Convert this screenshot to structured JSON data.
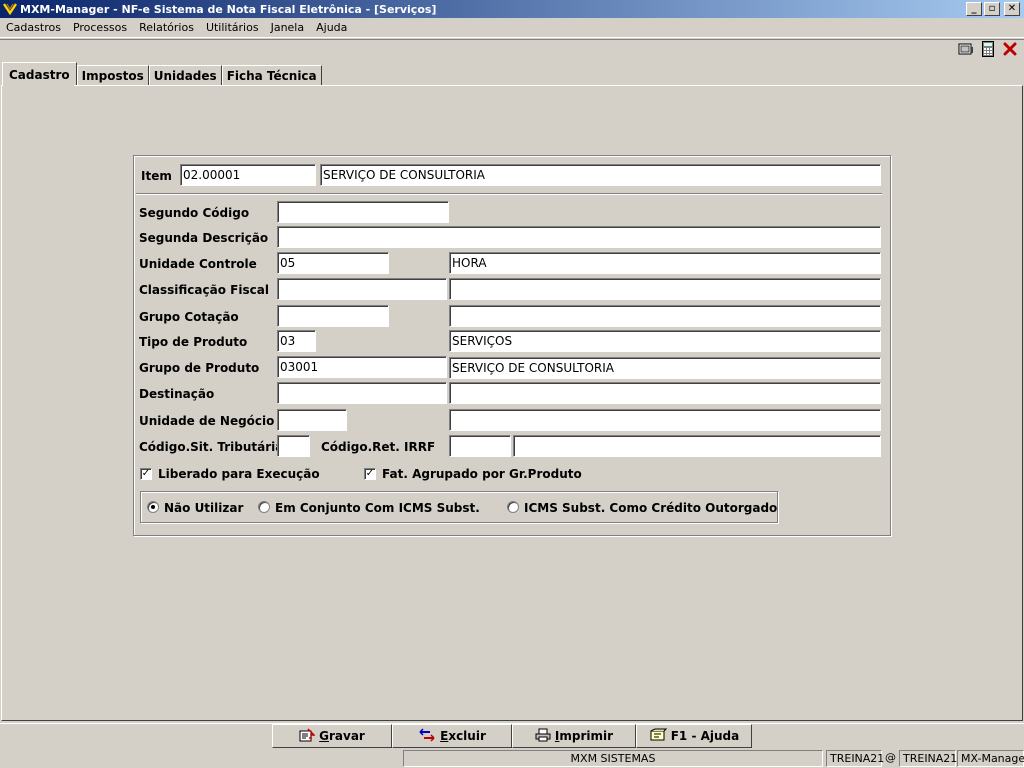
{
  "window": {
    "title": "MXM-Manager - NF-e Sistema de Nota Fiscal Eletrônica - [Serviços]",
    "minimize": "_",
    "restore": "▫",
    "close": "✕"
  },
  "menu": [
    "Cadastros",
    "Processos",
    "Relatórios",
    "Utilitários",
    "Janela",
    "Ajuda"
  ],
  "toolbar_icons": [
    "document-icon",
    "calculator-icon",
    "close-x-icon"
  ],
  "tabs": [
    "Cadastro",
    "Impostos",
    "Unidades",
    "Ficha Técnica"
  ],
  "active_tab": "Cadastro",
  "form": {
    "item_label": "Item",
    "item_code": "02.00001",
    "item_desc": "SERVIÇO DE CONSULTORIA",
    "segundo_codigo_label": "Segundo Código",
    "segundo_codigo": "",
    "segunda_descricao_label": "Segunda Descrição",
    "segunda_descricao": "",
    "unidade_controle_label": "Unidade Controle",
    "unidade_controle_code": "05",
    "unidade_controle_desc": "HORA",
    "classificacao_fiscal_label": "Classificação Fiscal",
    "classificacao_fiscal_code": "",
    "classificacao_fiscal_desc": "",
    "grupo_cotacao_label": "Grupo Cotação",
    "grupo_cotacao_code": "",
    "grupo_cotacao_desc": "",
    "tipo_produto_label": "Tipo de Produto",
    "tipo_produto_code": "03",
    "tipo_produto_desc": "SERVIÇOS",
    "grupo_produto_label": "Grupo de Produto",
    "grupo_produto_code": "03001",
    "grupo_produto_desc": "SERVIÇO DE CONSULTORIA",
    "destinacao_label": "Destinação",
    "destinacao_code": "",
    "destinacao_desc": "",
    "unidade_negocio_label": "Unidade de Negócio",
    "unidade_negocio_code": "",
    "unidade_negocio_desc": "",
    "cod_sit_trib_label": "Código.Sit. Tributária",
    "cod_sit_trib": "",
    "cod_ret_irrf_label": "Código.Ret. IRRF",
    "cod_ret_irrf_code": "",
    "cod_ret_irrf_desc": "",
    "liberado_label": "Liberado para Execução",
    "liberado_checked": true,
    "fat_agrupado_label": "Fat. Agrupado por Gr.Produto",
    "fat_agrupado_checked": true,
    "radio_options": [
      "Não Utilizar",
      "Em Conjunto Com ICMS Subst.",
      "ICMS Subst. Como Crédito Outorgado"
    ],
    "radio_selected": 0,
    "check_mark": "✓"
  },
  "buttons": {
    "gravar_first": "G",
    "gravar_rest": "ravar",
    "excluir_first": "E",
    "excluir_rest": "xcluir",
    "imprimir_first": "I",
    "imprimir_rest": "mprimir",
    "ajuda": "F1 - Ajuda"
  },
  "status": {
    "company": "MXM SISTEMAS",
    "user": "TREINA21",
    "at": "@",
    "db": "TREINA21",
    "app": "MX-Manager"
  }
}
